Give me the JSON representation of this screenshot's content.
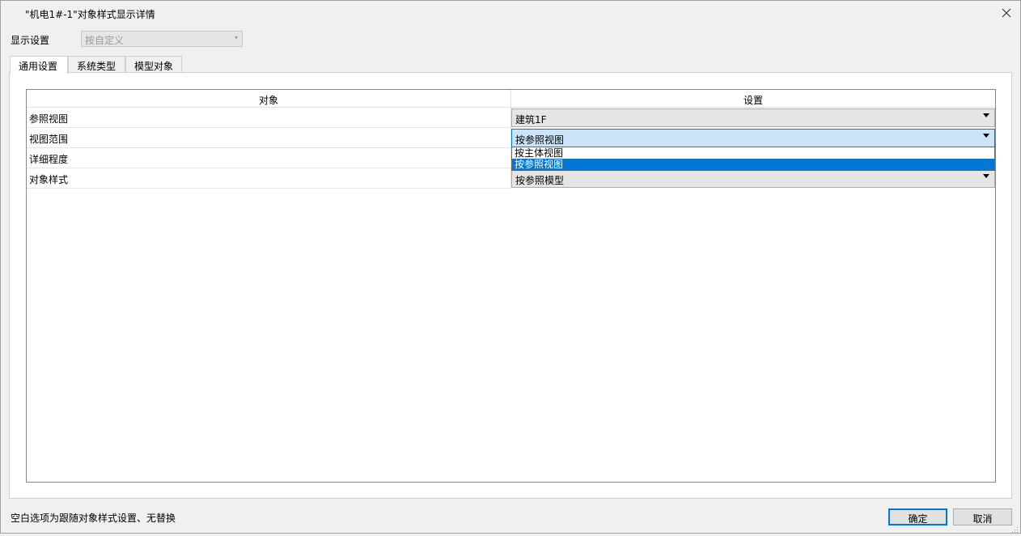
{
  "window": {
    "title": "\"机电1#-1\"对象样式显示详情",
    "close_icon": "close-icon"
  },
  "display_settings": {
    "label": "显示设置",
    "value": "按自定义",
    "arrow": "▾"
  },
  "tabs": [
    {
      "label": "通用设置",
      "active": true
    },
    {
      "label": "系统类型",
      "active": false
    },
    {
      "label": "模型对象",
      "active": false
    }
  ],
  "grid": {
    "headers": {
      "object": "对象",
      "setting": "设置"
    },
    "rows": [
      {
        "object": "参照视图",
        "value": "建筑1F"
      },
      {
        "object": "视图范围",
        "value": "按参照视图"
      },
      {
        "object": "详细程度",
        "value": ""
      },
      {
        "object": "对象样式",
        "value": "按参照模型"
      }
    ],
    "open_dropdown": {
      "row": "视图范围",
      "options": [
        "按主体视图",
        "按参照视图"
      ],
      "selected": "按参照视图"
    }
  },
  "footer": {
    "hint": "空白选项为跟随对象样式设置、无替换",
    "ok_label": "确定",
    "cancel_label": "取消"
  },
  "colors": {
    "accent": "#0078d7",
    "focused_combo_bg": "#cce4f7"
  }
}
